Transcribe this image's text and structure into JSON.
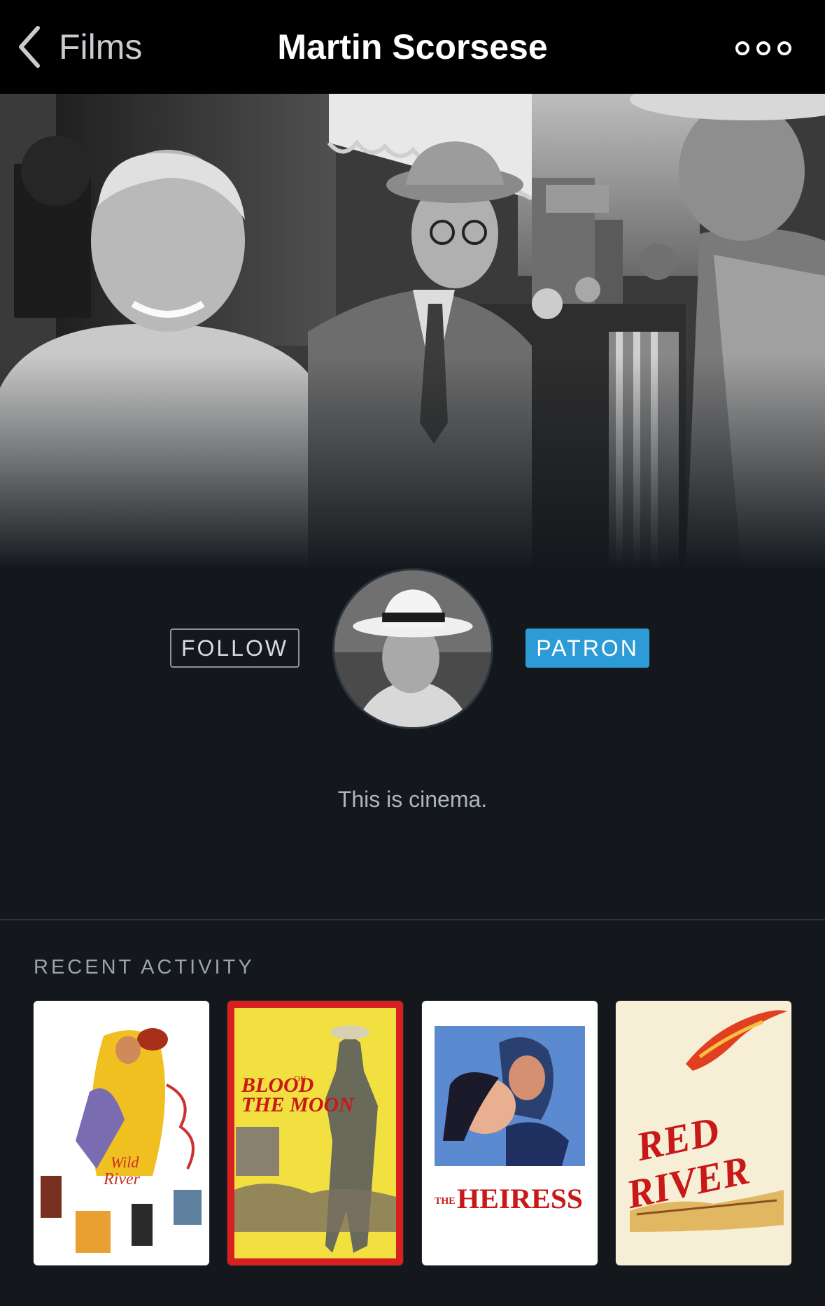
{
  "nav": {
    "back_label": "Films",
    "title": "Martin Scorsese"
  },
  "profile": {
    "follow_label": "FOLLOW",
    "patron_label": "PATRON",
    "bio": "This is cinema."
  },
  "activity": {
    "section_title": "RECENT ACTIVITY",
    "posters": [
      {
        "title": "Wild River",
        "accent": "#f0c020"
      },
      {
        "title": "Blood on the Moon",
        "accent": "#d82020"
      },
      {
        "title": "The Heiress",
        "accent": "#c81818"
      },
      {
        "title": "Red River",
        "accent": "#c01818"
      }
    ]
  },
  "colors": {
    "background": "#14181c",
    "topbar": "#000000",
    "patron": "#2d9bd6",
    "divider": "#2c3440"
  }
}
